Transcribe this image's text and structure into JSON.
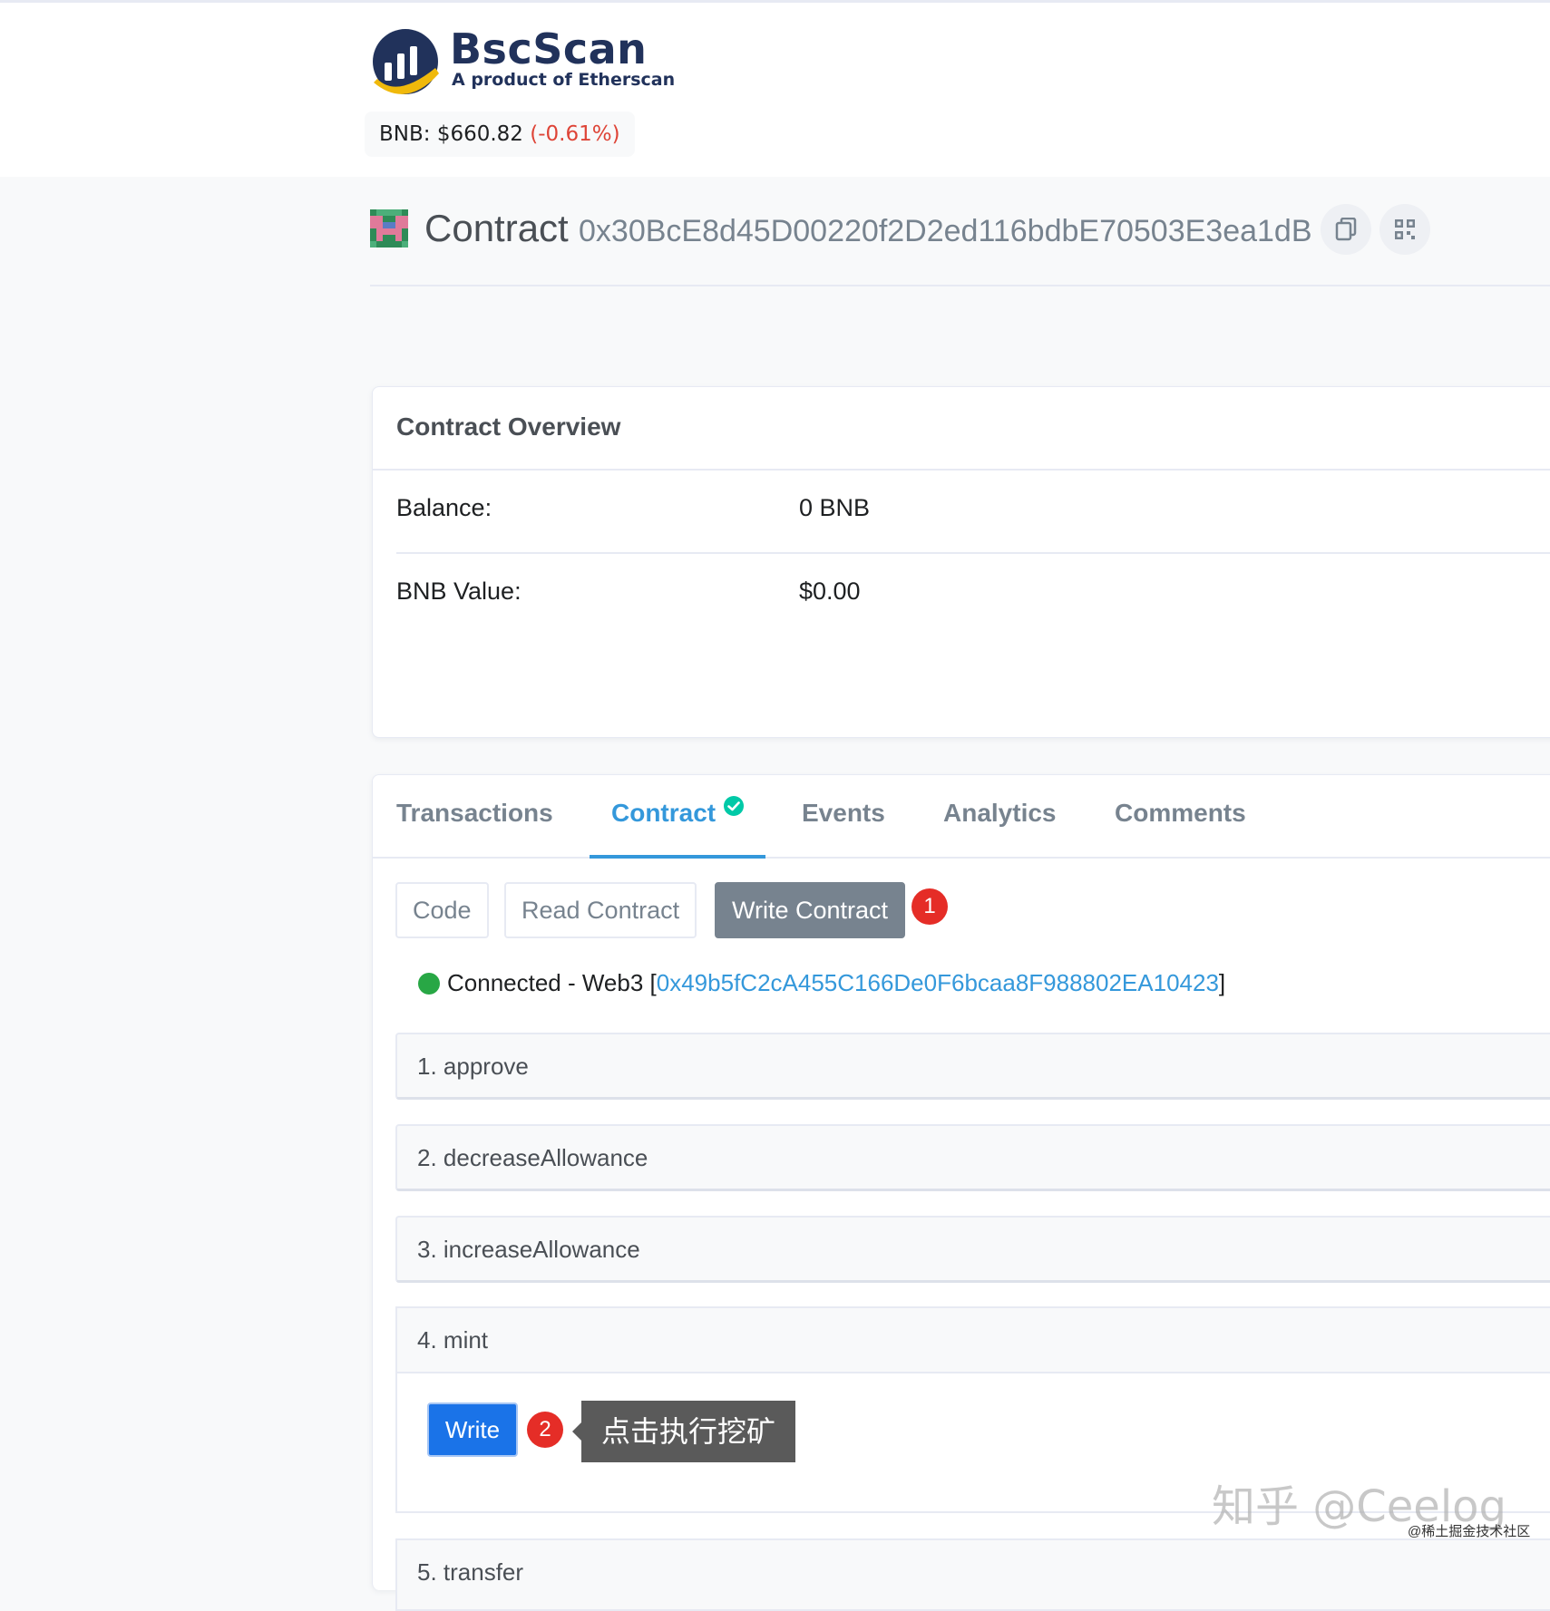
{
  "header": {
    "brand": "BscScan",
    "tagline": "A product of Etherscan",
    "price_label": "BNB: $660.82",
    "price_change": "(-0.61%)"
  },
  "title": {
    "label": "Contract",
    "address": "0x30BcE8d45D00220f2D2ed116bdbE70503E3ea1dB",
    "icons": [
      "copy-icon",
      "qr-code-icon"
    ]
  },
  "overview": {
    "title": "Contract Overview",
    "rows": [
      {
        "key": "Balance:",
        "value": "0 BNB"
      },
      {
        "key": "BNB Value:",
        "value": "$0.00"
      }
    ]
  },
  "tabs": {
    "items": [
      "Transactions",
      "Contract",
      "Events",
      "Analytics",
      "Comments"
    ],
    "active": "Contract"
  },
  "subtabs": {
    "code": "Code",
    "read": "Read Contract",
    "write": "Write Contract",
    "active": "Write Contract"
  },
  "annotations": {
    "badge1": "1",
    "badge2": "2",
    "tooltip": "点击执行挖矿"
  },
  "web3": {
    "status": "Connected - Web3 [",
    "address": "0x49b5fC2cA455C166De0F6bcaa8F988802EA10423",
    "close": "]"
  },
  "functions": [
    {
      "label": "1. approve"
    },
    {
      "label": "2. decreaseAllowance"
    },
    {
      "label": "3. increaseAllowance"
    },
    {
      "label": "4. mint"
    },
    {
      "label": "5. transfer"
    }
  ],
  "write_button": "Write",
  "watermark": {
    "main": "知乎 @Ceelog",
    "sub": "@稀土掘金技术社区"
  },
  "colors": {
    "accent": "#3498db",
    "write_button": "#1a73e8",
    "connected": "#28a745",
    "badge": "#e52d27",
    "price_down": "#de4437"
  }
}
